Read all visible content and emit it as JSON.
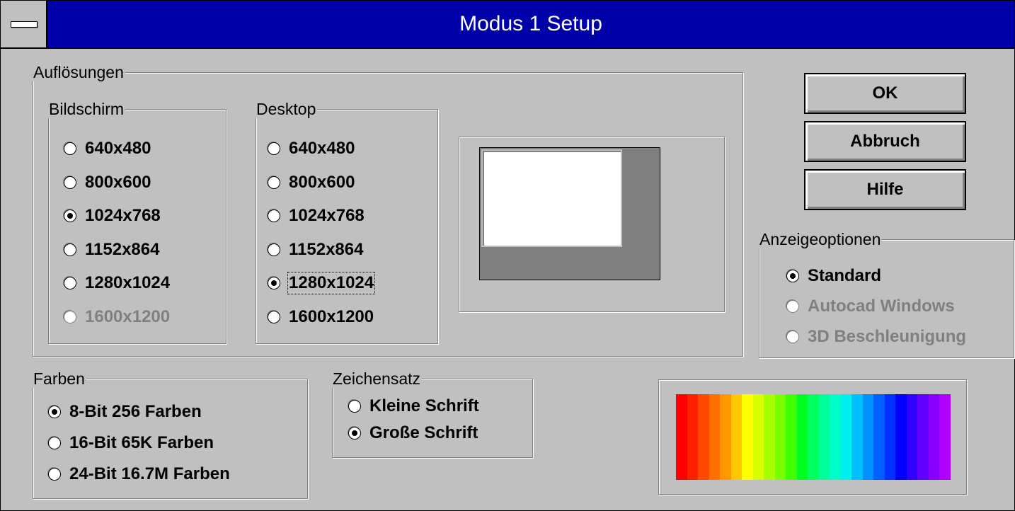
{
  "window": {
    "title": "Modus 1 Setup"
  },
  "resolutions": {
    "label": "Auflösungen",
    "screen": {
      "label": "Bildschirm",
      "options": [
        {
          "label": "640x480",
          "checked": false,
          "disabled": false
        },
        {
          "label": "800x600",
          "checked": false,
          "disabled": false
        },
        {
          "label": "1024x768",
          "checked": true,
          "disabled": false
        },
        {
          "label": "1152x864",
          "checked": false,
          "disabled": false
        },
        {
          "label": "1280x1024",
          "checked": false,
          "disabled": false
        },
        {
          "label": "1600x1200",
          "checked": false,
          "disabled": true
        }
      ]
    },
    "desktop": {
      "label": "Desktop",
      "options": [
        {
          "label": "640x480",
          "checked": false,
          "disabled": false
        },
        {
          "label": "800x600",
          "checked": false,
          "disabled": false
        },
        {
          "label": "1024x768",
          "checked": false,
          "disabled": false
        },
        {
          "label": "1152x864",
          "checked": false,
          "disabled": false
        },
        {
          "label": "1280x1024",
          "checked": true,
          "disabled": false
        },
        {
          "label": "1600x1200",
          "checked": false,
          "disabled": false
        }
      ]
    }
  },
  "buttons": {
    "ok": "OK",
    "cancel": "Abbruch",
    "help": "Hilfe"
  },
  "display_options": {
    "label": "Anzeigeoptionen",
    "options": [
      {
        "label": "Standard",
        "checked": true,
        "disabled": false
      },
      {
        "label": "Autocad Windows",
        "checked": false,
        "disabled": true
      },
      {
        "label": "3D Beschleunigung",
        "checked": false,
        "disabled": true
      }
    ]
  },
  "colors": {
    "label": "Farben",
    "options": [
      {
        "label": "8-Bit 256 Farben",
        "checked": true,
        "disabled": false
      },
      {
        "label": "16-Bit 65K Farben",
        "checked": false,
        "disabled": false
      },
      {
        "label": "24-Bit 16.7M Farben",
        "checked": false,
        "disabled": false
      }
    ]
  },
  "font_size": {
    "label": "Zeichensatz",
    "options": [
      {
        "label": "Kleine Schrift",
        "checked": false,
        "disabled": false
      },
      {
        "label": "Große Schrift",
        "checked": true,
        "disabled": false
      }
    ]
  },
  "palette_colors": [
    "#ff0000",
    "#ff2000",
    "#ff4800",
    "#ff7000",
    "#ff9800",
    "#ffc800",
    "#ffff00",
    "#d8ff00",
    "#a8ff00",
    "#78ff00",
    "#40ff00",
    "#00ff20",
    "#00ff60",
    "#00ff98",
    "#00ffc8",
    "#00f0f0",
    "#00c0ff",
    "#0090ff",
    "#0060ff",
    "#0030ff",
    "#0000ff",
    "#3000ff",
    "#6000ff",
    "#8800ff",
    "#b000ff"
  ]
}
